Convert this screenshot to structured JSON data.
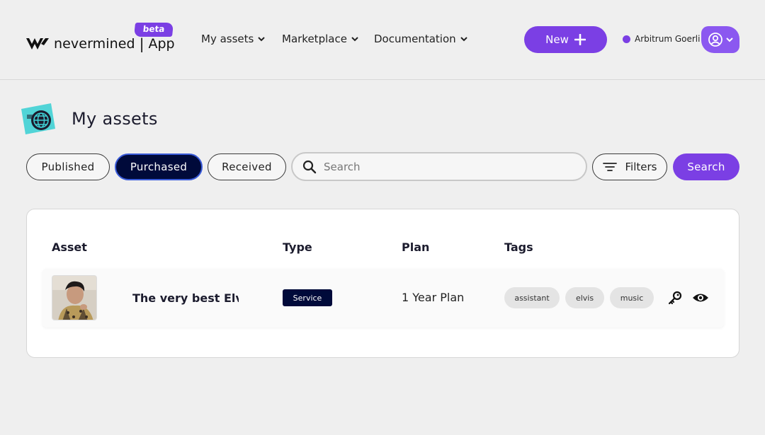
{
  "header": {
    "logo_text": "nevermined",
    "logo_separator": "|",
    "logo_app": "App",
    "beta_label": "beta",
    "nav": [
      {
        "label": "My assets"
      },
      {
        "label": "Marketplace"
      },
      {
        "label": "Documentation"
      }
    ],
    "new_button_label": "New",
    "network_label": "Arbitrum Goerli"
  },
  "page": {
    "title": "My assets"
  },
  "toolbar": {
    "tabs": [
      {
        "label": "Published",
        "active": false
      },
      {
        "label": "Purchased",
        "active": true
      },
      {
        "label": "Received",
        "active": false
      }
    ],
    "search_placeholder": "Search",
    "search_value": "",
    "filters_label": "Filters",
    "search_button_label": "Search"
  },
  "table": {
    "headers": [
      "Asset",
      "Type",
      "Plan",
      "Tags"
    ],
    "rows": [
      {
        "name": "The very best Elvi...",
        "type": "Service",
        "plan": "1 Year Plan",
        "tags": [
          "assistant",
          "elvis",
          "music"
        ],
        "actions": [
          "key-icon",
          "eye-icon"
        ]
      }
    ]
  },
  "colors": {
    "accent": "#7b3fe4",
    "dark_navy": "#000a3a",
    "background": "#efefef",
    "title_icon_teal": "#3fd0d4"
  },
  "icons": {
    "nav_chevron": "chevron-down-icon",
    "new_button": "plus-icon",
    "account": "user-circle-icon",
    "search": "search-icon",
    "filters": "filter-icon"
  }
}
